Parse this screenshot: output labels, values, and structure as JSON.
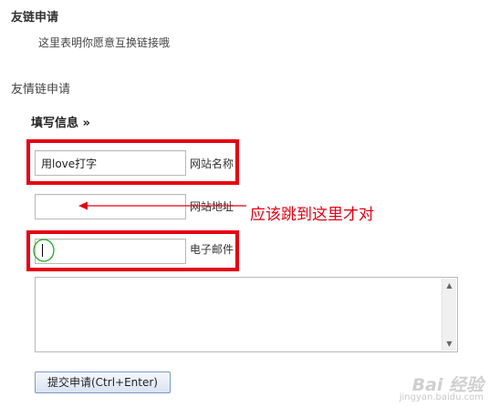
{
  "section": {
    "title": "友链申请",
    "description": "这里表明你愿意互换链接哦"
  },
  "form": {
    "header": "友情链申请",
    "subheader": "填写信息 »",
    "site_name": {
      "value": "用love打字",
      "label": "网站名称"
    },
    "site_url": {
      "value": "",
      "label": "网站地址"
    },
    "email": {
      "value": "",
      "label": "电子邮件"
    },
    "message": {
      "value": ""
    },
    "submit_label": "提交申请(Ctrl+Enter)"
  },
  "annotation": {
    "text": "应该跳到这里才对",
    "color": "#e60012"
  },
  "watermark": {
    "brand": "Bai 经验",
    "url": "jingyan.baidu.com"
  },
  "colors": {
    "highlight_box": "#e60012",
    "focus_circle": "#22aa22"
  },
  "icons": {
    "scroll_up": "▲",
    "scroll_down": "▼"
  }
}
